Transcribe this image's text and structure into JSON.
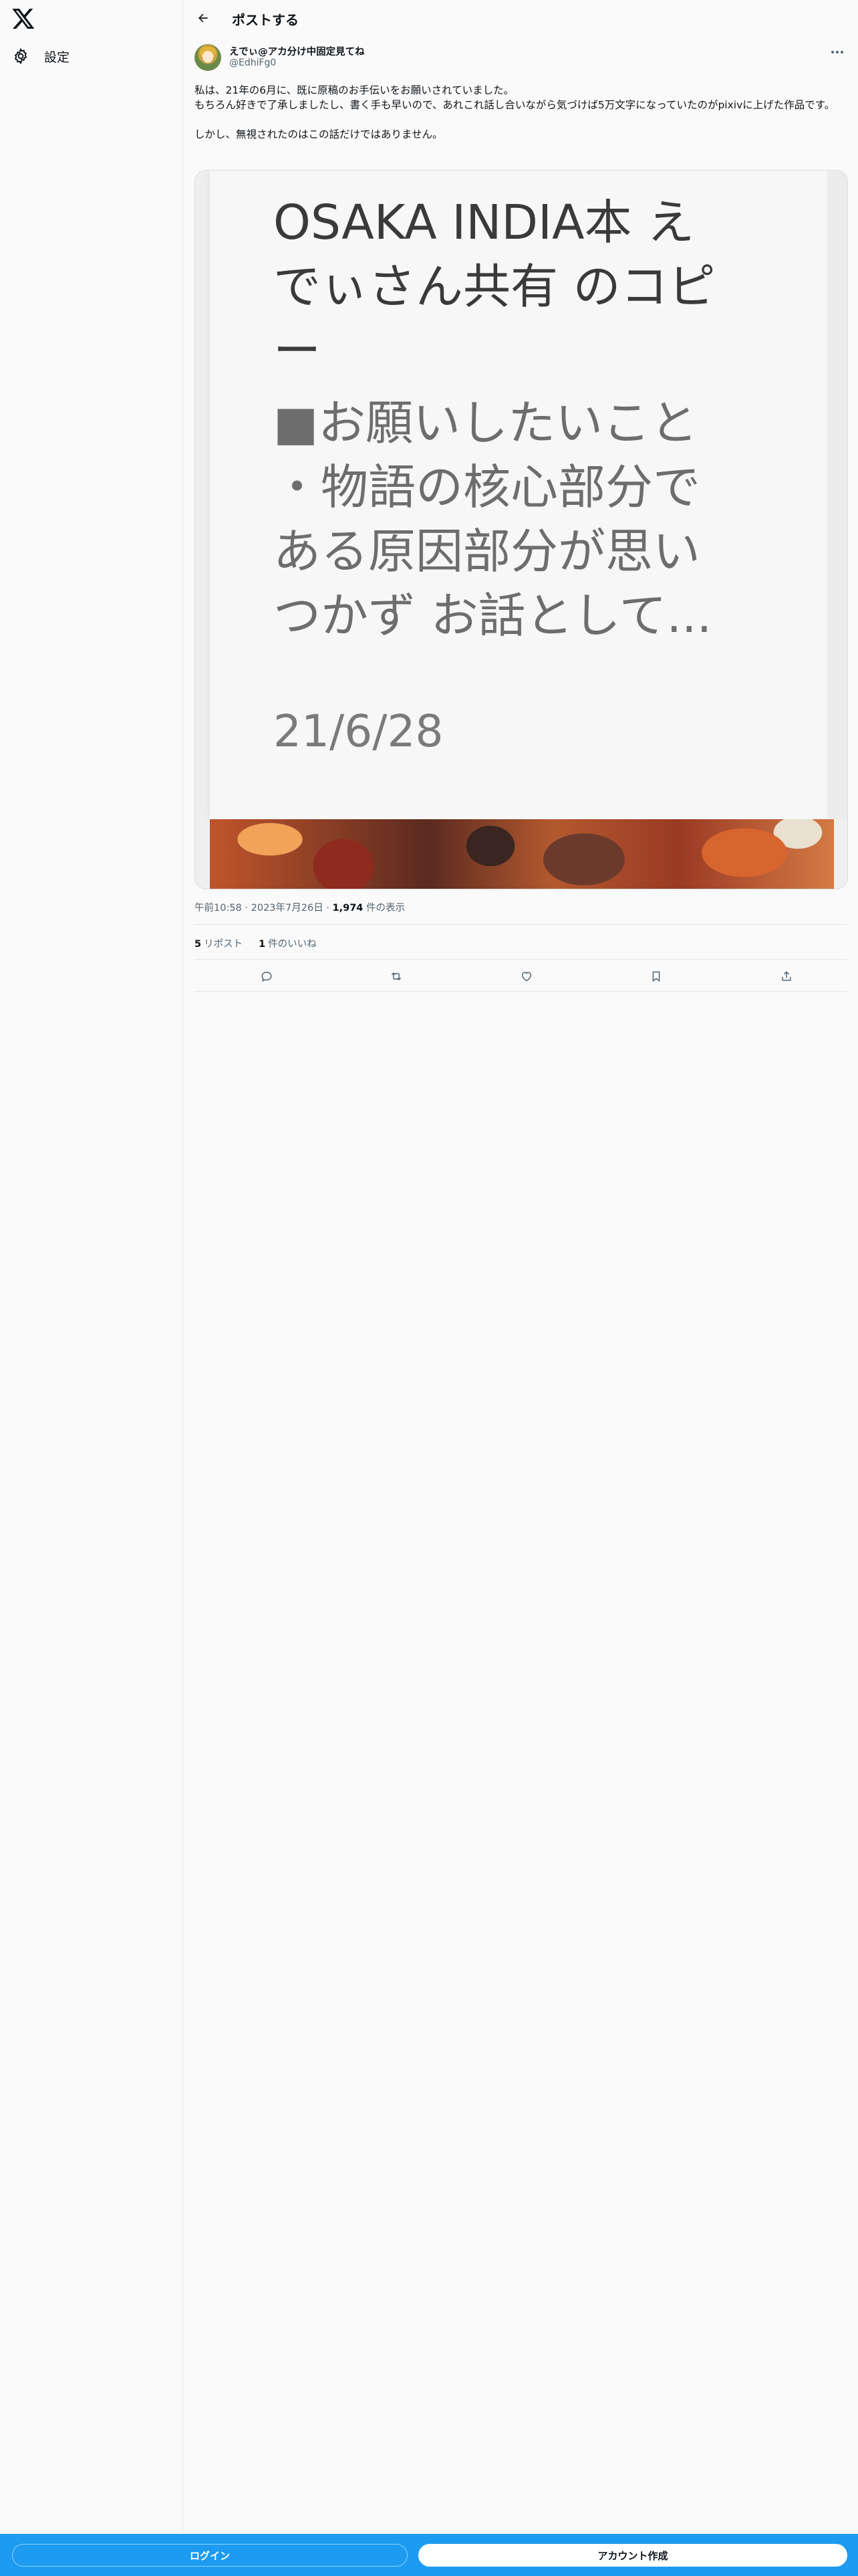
{
  "sidebar": {
    "logo_icon": "x-logo-icon",
    "items": [
      {
        "label": "設定",
        "icon": "gear-icon"
      }
    ]
  },
  "header": {
    "title": "ポストする",
    "back_icon": "arrow-left-icon"
  },
  "post": {
    "author": {
      "display_name": "えでぃ@アカ分け中固定見てね",
      "handle": "@EdhiFg0"
    },
    "more_icon": "more-horizontal-icon",
    "text_lines": [
      "私は、21年の6月に、既に原稿のお手伝いをお願いされていました。",
      "もちろん好きで了承しましたし、書く手も早いので、あれこれ話し合いながら気づけば5万文字になっていたのがpixivに上げた作品です。",
      "",
      "しかし、無視されたのはこの話だけではありません。"
    ],
    "media": {
      "title_line1": "OSAKA INDIA本 え",
      "title_line2": "でぃさん共有 のコピ",
      "title_line3": "ー",
      "body_line1": "■お願いしたいこと",
      "body_line2": "・物語の核心部分で",
      "body_line3": "ある原因部分が思い",
      "body_line4": "つかず お話として...",
      "date": "21/6/28"
    },
    "meta": {
      "time": "午前10:58",
      "sep1": "·",
      "date": "2023年7月26日",
      "sep2": "·",
      "views_count": "1,974",
      "views_label": "件の表示"
    },
    "stats": {
      "reposts_count": "5",
      "reposts_label": "リポスト",
      "likes_count": "1",
      "likes_label": "件のいいね"
    },
    "actions": [
      "reply-icon",
      "repost-icon",
      "like-icon",
      "bookmark-icon",
      "share-icon"
    ]
  },
  "bottom_bar": {
    "login_label": "ログイン",
    "signup_label": "アカウント作成"
  },
  "colors": {
    "accent": "#1d9bf0",
    "text": "#0f1419",
    "secondary": "#536471"
  }
}
